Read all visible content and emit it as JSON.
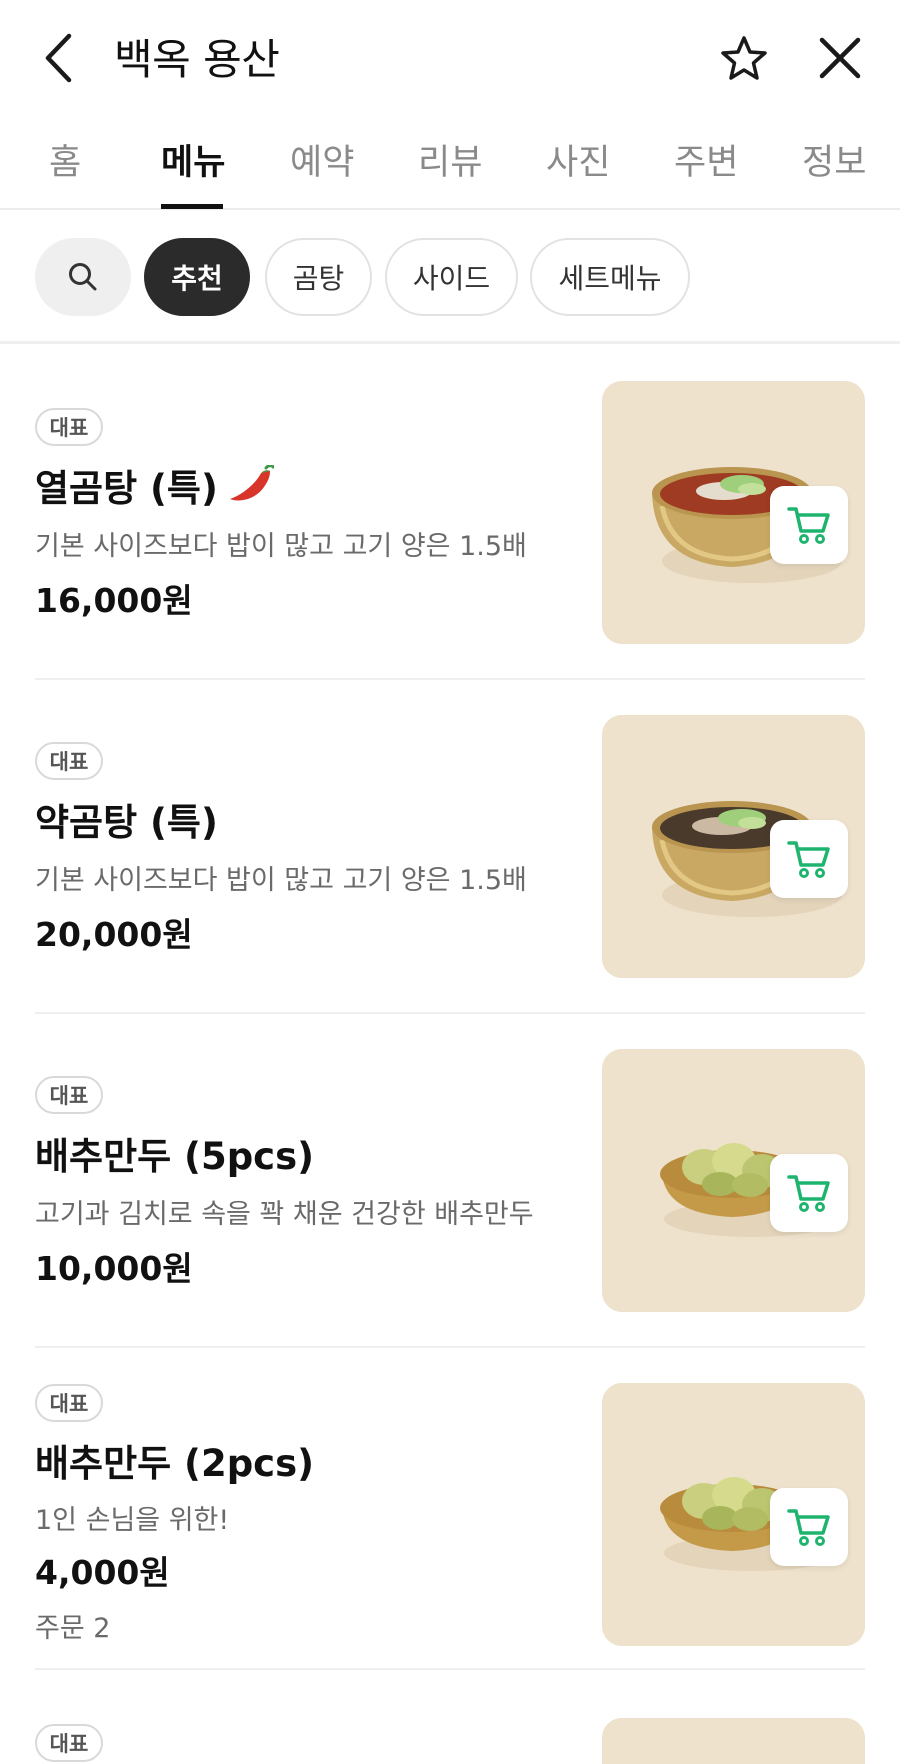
{
  "header": {
    "title": "백옥 용산",
    "back_icon": "chevron-left-icon",
    "favorite_icon": "star-outline-icon",
    "close_icon": "close-icon"
  },
  "tabs": [
    {
      "label": "홈",
      "active": false
    },
    {
      "label": "메뉴",
      "active": true
    },
    {
      "label": "예약",
      "active": false
    },
    {
      "label": "리뷰",
      "active": false
    },
    {
      "label": "사진",
      "active": false
    },
    {
      "label": "주변",
      "active": false
    },
    {
      "label": "정보",
      "active": false
    }
  ],
  "filters": {
    "search_icon": "search-icon",
    "chips": [
      {
        "label": "추천",
        "active": true
      },
      {
        "label": "곰탕",
        "active": false
      },
      {
        "label": "사이드",
        "active": false
      },
      {
        "label": "세트메뉴",
        "active": false
      }
    ]
  },
  "menu": [
    {
      "badge": "대표",
      "name": "열곰탕 (특)",
      "spicy_icon": "chili-pepper-icon",
      "description": "기본 사이즈보다 밥이 많고 고기 양은 1.5배",
      "price": "16,000원",
      "orders": "",
      "photo": "red-soup-brass-bowl"
    },
    {
      "badge": "대표",
      "name": "약곰탕 (특)",
      "description": "기본 사이즈보다 밥이 많고 고기 양은 1.5배",
      "price": "20,000원",
      "orders": "",
      "photo": "clear-soup-brass-bowl"
    },
    {
      "badge": "대표",
      "name": "배추만두 (5pcs)",
      "description": "고기과 김치로 속을 꽉 채운 건강한 배추만두",
      "price": "10,000원",
      "orders": "",
      "photo": "cabbage-dumplings-brass-plate"
    },
    {
      "badge": "대표",
      "name": "배추만두 (2pcs)",
      "description": "1인 손님을 위한!",
      "price": "4,000원",
      "orders": "주문 2",
      "photo": "cabbage-dumplings-brass-plate"
    },
    {
      "badge": "대표"
    }
  ],
  "colors": {
    "accent_green": "#1fb46e",
    "active_chip_bg": "#2b2b2b",
    "photo_bg": "#eee2cd",
    "chili_red": "#d8342a"
  }
}
